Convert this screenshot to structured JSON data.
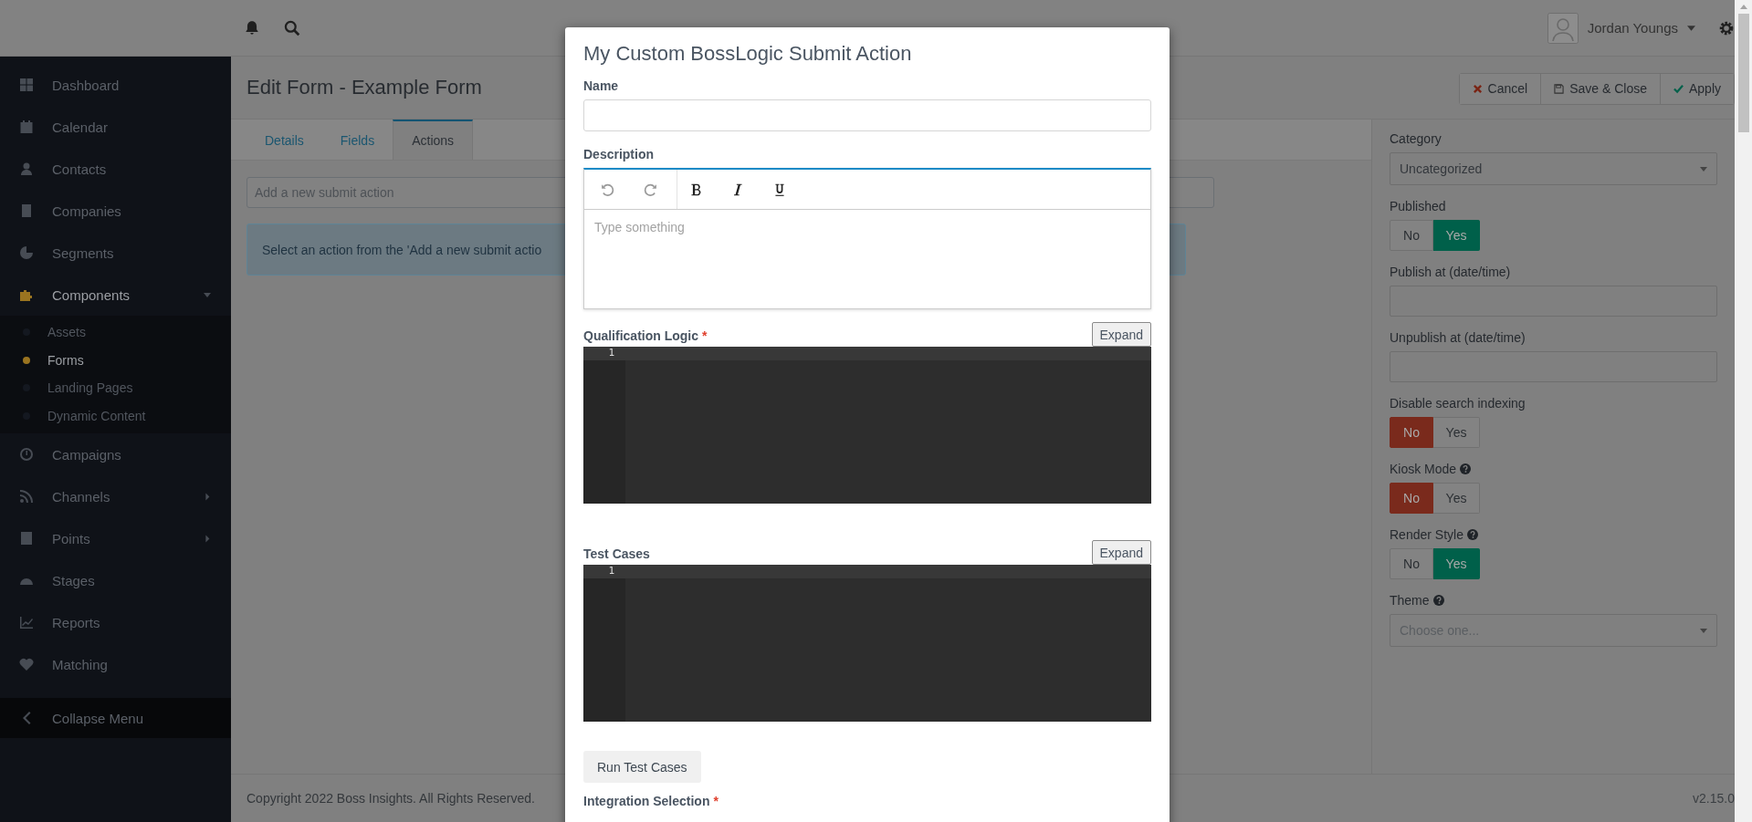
{
  "topbar": {
    "user_name": "Jordan Youngs"
  },
  "sidebar": {
    "items": [
      {
        "label": "Dashboard",
        "kind": "link",
        "selected": false
      },
      {
        "label": "Calendar",
        "kind": "link",
        "selected": false
      },
      {
        "label": "Contacts",
        "kind": "link",
        "selected": false
      },
      {
        "label": "Companies",
        "kind": "link",
        "selected": false
      },
      {
        "label": "Segments",
        "kind": "link",
        "selected": false
      },
      {
        "label": "Components",
        "kind": "menu",
        "selected": true,
        "expanded": true,
        "children": [
          {
            "label": "Assets",
            "selected": false
          },
          {
            "label": "Forms",
            "selected": true
          },
          {
            "label": "Landing Pages",
            "selected": false
          },
          {
            "label": "Dynamic Content",
            "selected": false
          }
        ]
      },
      {
        "label": "Campaigns",
        "kind": "link",
        "selected": false
      },
      {
        "label": "Channels",
        "kind": "menu",
        "selected": false,
        "expanded": false
      },
      {
        "label": "Points",
        "kind": "menu",
        "selected": false,
        "expanded": false
      },
      {
        "label": "Stages",
        "kind": "link",
        "selected": false
      },
      {
        "label": "Reports",
        "kind": "link",
        "selected": false
      },
      {
        "label": "Matching",
        "kind": "link",
        "selected": false
      }
    ],
    "collapse_label": "Collapse Menu"
  },
  "page": {
    "title": "Edit Form - Example Form",
    "buttons": [
      {
        "label": "Cancel",
        "kind": "cancel"
      },
      {
        "label": "Save & Close",
        "kind": "save"
      },
      {
        "label": "Apply",
        "kind": "apply"
      }
    ],
    "tabs": [
      {
        "label": "Details",
        "selected": false
      },
      {
        "label": "Fields",
        "selected": false
      },
      {
        "label": "Actions",
        "selected": true
      }
    ],
    "action_select": {
      "placeholder": "Add a new submit action"
    },
    "info_message": "Select an action from the 'Add a new submit actio"
  },
  "settings": [
    {
      "kind": "select",
      "label": "Category",
      "value": "Uncategorized",
      "help": false
    },
    {
      "kind": "toggle",
      "label": "Published",
      "help": false,
      "options": [
        {
          "label": "No",
          "selected": false
        },
        {
          "label": "Yes",
          "selected": true
        }
      ]
    },
    {
      "kind": "input",
      "label": "Publish at (date/time)",
      "help": false
    },
    {
      "kind": "input",
      "label": "Unpublish at (date/time)",
      "help": false
    },
    {
      "kind": "toggle",
      "label": "Disable search indexing",
      "help": false,
      "options": [
        {
          "label": "No",
          "selected": true
        },
        {
          "label": "Yes",
          "selected": false
        }
      ]
    },
    {
      "kind": "toggle",
      "label": "Kiosk Mode",
      "help": true,
      "options": [
        {
          "label": "No",
          "selected": true
        },
        {
          "label": "Yes",
          "selected": false
        }
      ]
    },
    {
      "kind": "toggle",
      "label": "Render Style",
      "help": true,
      "options": [
        {
          "label": "No",
          "selected": false
        },
        {
          "label": "Yes",
          "selected": true
        }
      ]
    },
    {
      "kind": "select",
      "label": "Theme",
      "placeholder": "Choose one...",
      "help": true
    }
  ],
  "footer": {
    "copyright": "Copyright 2022 Boss Insights. All Rights Reserved.",
    "version": "v2.15.0"
  },
  "modal": {
    "title": "My Custom BossLogic Submit Action",
    "name_label": "Name",
    "description_label": "Description",
    "description_placeholder": "Type something",
    "editors": [
      {
        "label": "Qualification Logic",
        "required_mark": "*",
        "expand": "Expand",
        "line_number": "1"
      },
      {
        "label": "Test Cases",
        "expand": "Expand",
        "line_number": "1"
      }
    ],
    "run_button": "Run Test Cases",
    "integration_label": "Integration Selection",
    "integration_required_mark": "*"
  }
}
